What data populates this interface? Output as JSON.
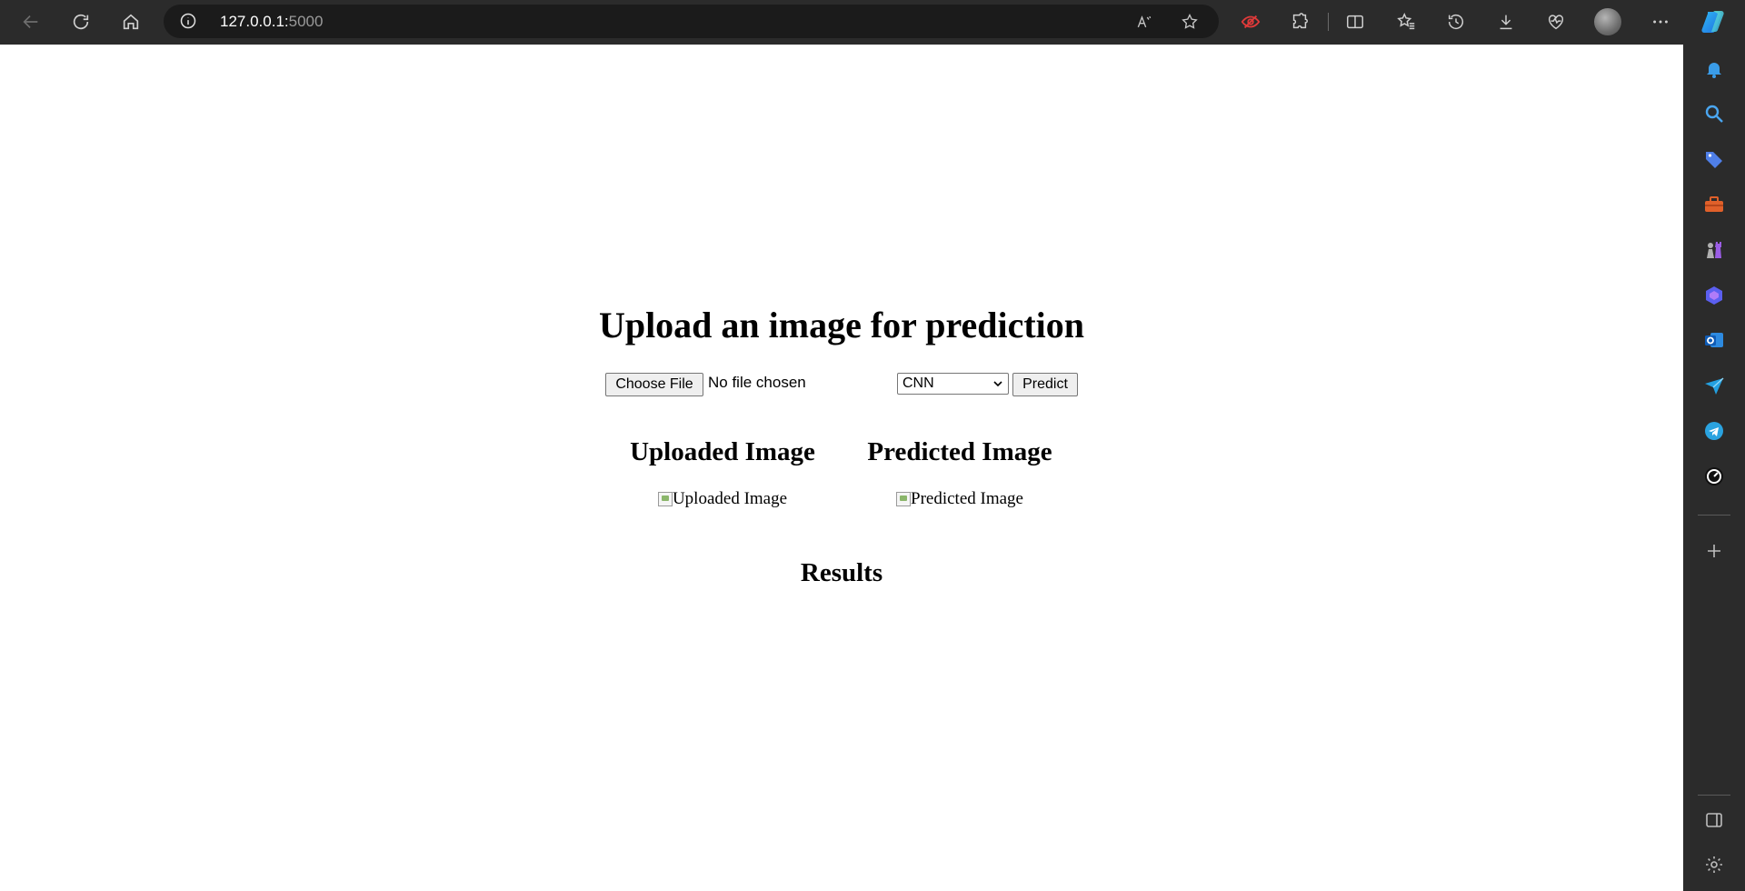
{
  "browser": {
    "url_host": "127.0.0.1:",
    "url_port": "5000"
  },
  "page": {
    "heading": "Upload an image for prediction",
    "file_button_label": "Choose File",
    "file_status": "No file chosen",
    "model_select_value": "CNN",
    "predict_button_label": "Predict",
    "uploaded_heading": "Uploaded Image",
    "uploaded_alt": "Uploaded Image",
    "predicted_heading": "Predicted Image",
    "predicted_alt": "Predicted Image",
    "results_heading": "Results"
  },
  "colors": {
    "toolbar_bg": "#2b2b2b",
    "address_bg": "#1b1b1b",
    "page_bg": "#ffffff",
    "button_bg": "#efefef"
  }
}
